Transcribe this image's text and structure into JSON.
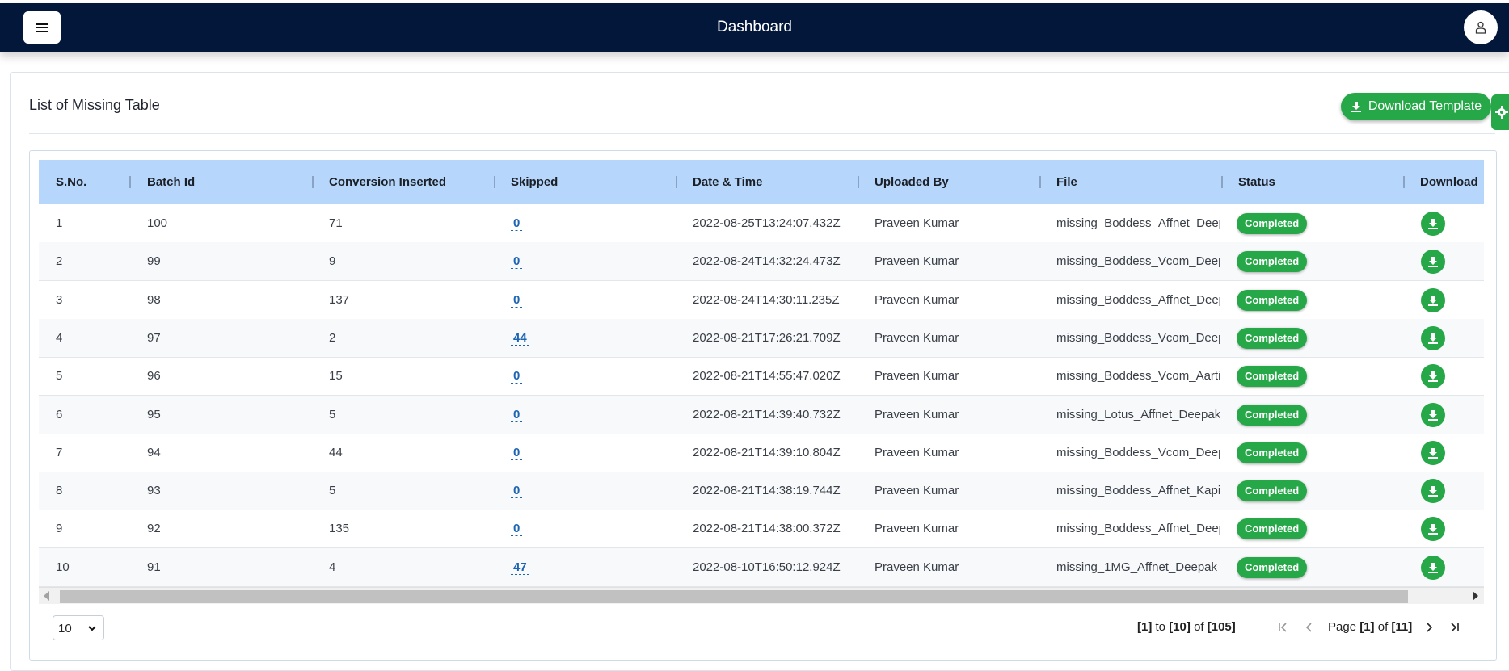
{
  "header": {
    "title": "Dashboard",
    "menu_icon": "hamburger-icon",
    "user_icon": "user-icon"
  },
  "card": {
    "title": "List of Missing Table",
    "download_template_label": "Download Template"
  },
  "table": {
    "columns": [
      "S.No.",
      "Batch Id",
      "Conversion Inserted",
      "Skipped",
      "Date & Time",
      "Uploaded By",
      "File",
      "Status",
      "Download"
    ],
    "rows": [
      {
        "sno": "1",
        "batch": "100",
        "conv": "71",
        "skipped": "0",
        "datetime": "2022-08-25T13:24:07.432Z",
        "by": "Praveen Kumar",
        "file": "missing_Boddess_Affnet_Deep",
        "status": "Completed"
      },
      {
        "sno": "2",
        "batch": "99",
        "conv": "9",
        "skipped": "0",
        "datetime": "2022-08-24T14:32:24.473Z",
        "by": "Praveen Kumar",
        "file": "missing_Boddess_Vcom_Deep",
        "status": "Completed"
      },
      {
        "sno": "3",
        "batch": "98",
        "conv": "137",
        "skipped": "0",
        "datetime": "2022-08-24T14:30:11.235Z",
        "by": "Praveen Kumar",
        "file": "missing_Boddess_Affnet_Deep",
        "status": "Completed"
      },
      {
        "sno": "4",
        "batch": "97",
        "conv": "2",
        "skipped": "44",
        "datetime": "2022-08-21T17:26:21.709Z",
        "by": "Praveen Kumar",
        "file": "missing_Boddess_Vcom_Deep",
        "status": "Completed"
      },
      {
        "sno": "5",
        "batch": "96",
        "conv": "15",
        "skipped": "0",
        "datetime": "2022-08-21T14:55:47.020Z",
        "by": "Praveen Kumar",
        "file": "missing_Boddess_Vcom_Aarti",
        "status": "Completed"
      },
      {
        "sno": "6",
        "batch": "95",
        "conv": "5",
        "skipped": "0",
        "datetime": "2022-08-21T14:39:40.732Z",
        "by": "Praveen Kumar",
        "file": "missing_Lotus_Affnet_Deepak",
        "status": "Completed"
      },
      {
        "sno": "7",
        "batch": "94",
        "conv": "44",
        "skipped": "0",
        "datetime": "2022-08-21T14:39:10.804Z",
        "by": "Praveen Kumar",
        "file": "missing_Boddess_Vcom_Deep",
        "status": "Completed"
      },
      {
        "sno": "8",
        "batch": "93",
        "conv": "5",
        "skipped": "0",
        "datetime": "2022-08-21T14:38:19.744Z",
        "by": "Praveen Kumar",
        "file": "missing_Boddess_Affnet_Kapi",
        "status": "Completed"
      },
      {
        "sno": "9",
        "batch": "92",
        "conv": "135",
        "skipped": "0",
        "datetime": "2022-08-21T14:38:00.372Z",
        "by": "Praveen Kumar",
        "file": "missing_Boddess_Affnet_Deep",
        "status": "Completed"
      },
      {
        "sno": "10",
        "batch": "91",
        "conv": "4",
        "skipped": "47",
        "datetime": "2022-08-10T16:50:12.924Z",
        "by": "Praveen Kumar",
        "file": "missing_1MG_Affnet_Deepak",
        "status": "Completed"
      }
    ]
  },
  "pagination": {
    "page_size": "10",
    "from": "[1]",
    "to_word": "to",
    "to": "[10]",
    "of_word": "of",
    "total": "[105]",
    "page_word": "Page",
    "page": "[1]",
    "page_of": "of",
    "pages": "[11]"
  },
  "colors": {
    "header_bg": "#03173a",
    "accent_green": "#26a848",
    "table_header": "#b6d7fb",
    "link_blue": "#1c64b4"
  }
}
